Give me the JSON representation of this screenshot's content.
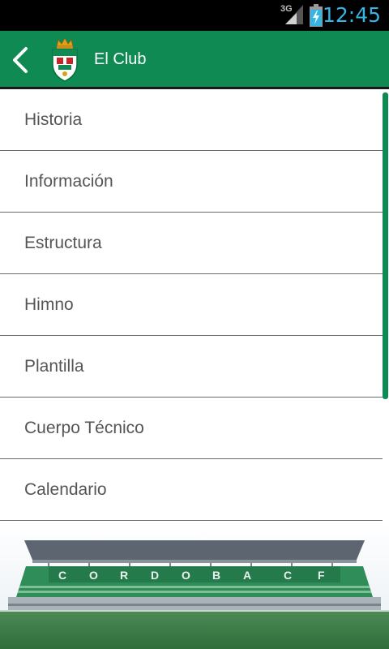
{
  "status_bar": {
    "network": "3G",
    "time": "12:45"
  },
  "header": {
    "title": "El Club"
  },
  "menu": {
    "items": [
      {
        "label": "Historia"
      },
      {
        "label": "Información"
      },
      {
        "label": "Estructura"
      },
      {
        "label": "Himno"
      },
      {
        "label": "Plantilla"
      },
      {
        "label": "Cuerpo Técnico"
      },
      {
        "label": "Calendario"
      }
    ]
  },
  "stadium": {
    "lettering": "CORDOBA CF"
  },
  "colors": {
    "brand_green": "#0e8a52",
    "status_time": "#33b5e5",
    "menu_text": "#555555",
    "divider": "#6a6a6a"
  },
  "icons": {
    "back": "chevron-left-icon",
    "crest": "club-crest-icon",
    "signal": "signal-icon",
    "battery": "battery-charging-icon"
  }
}
